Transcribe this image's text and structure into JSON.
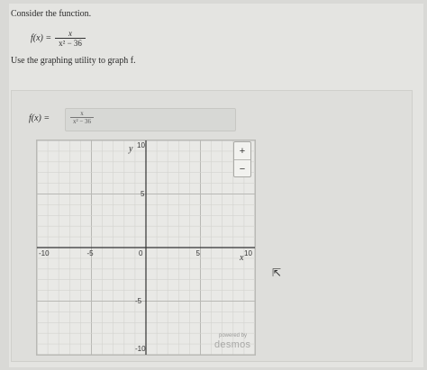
{
  "question": {
    "prompt": "Consider the function.",
    "fname": "f(x) =",
    "numerator": "x",
    "denominator": "x² − 36",
    "instruction": "Use the graphing utility to graph f."
  },
  "answer": {
    "fname": "f(x) =",
    "numerator": "x",
    "denominator": "x² − 36"
  },
  "graph": {
    "x_ticks": [
      {
        "label": "-10",
        "value": -10
      },
      {
        "label": "-5",
        "value": -5
      },
      {
        "label": "0",
        "value": 0
      },
      {
        "label": "5",
        "value": 5
      },
      {
        "label": "10",
        "value": 10
      }
    ],
    "y_ticks": [
      {
        "label": "10",
        "value": 10
      },
      {
        "label": "5",
        "value": 5
      },
      {
        "label": "-5",
        "value": -5
      },
      {
        "label": "-10",
        "value": -10
      }
    ],
    "x_label": "x",
    "y_label": "y",
    "x_range": [
      -10,
      10
    ],
    "y_range": [
      -10,
      10
    ],
    "grid": true
  },
  "controls": {
    "zoom_in": "+",
    "zoom_out": "−"
  },
  "branding": {
    "powered": "powered by",
    "name": "desmos"
  },
  "icons": {
    "cursor": "mouse-pointer-icon"
  }
}
